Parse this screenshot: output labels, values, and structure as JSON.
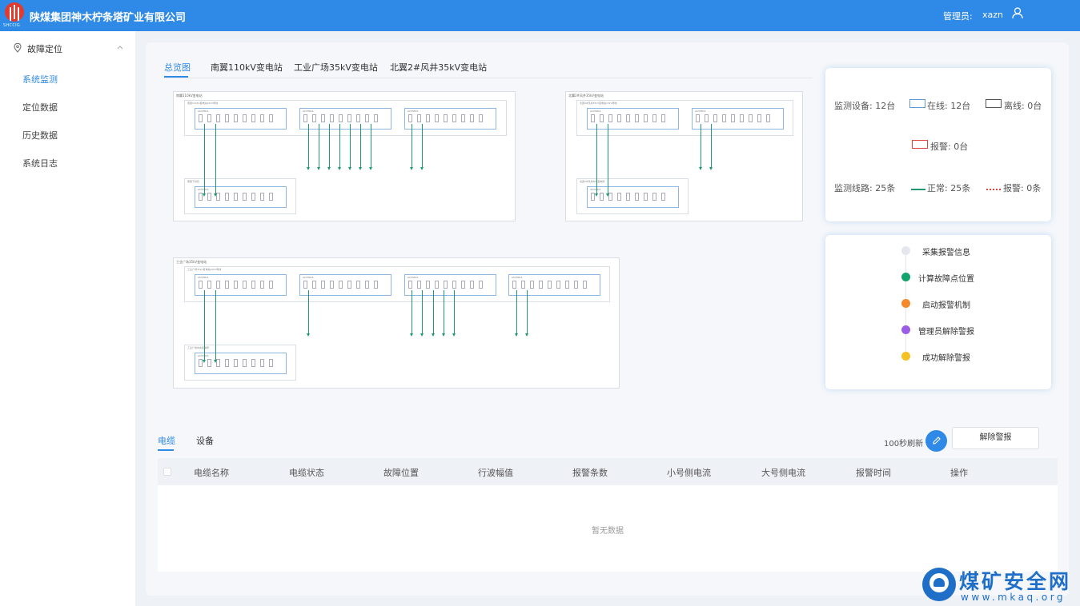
{
  "header": {
    "logo_text": "SHCCIG",
    "title": "陕煤集团神木柠条塔矿业有限公司",
    "admin_label": "管理员:",
    "admin_user": "xazn",
    "user_icon": "user-icon"
  },
  "sidebar": {
    "group_label": "故障定位",
    "group_icon": "location-pin-icon",
    "items": [
      {
        "label": "系统监测",
        "active": true
      },
      {
        "label": "定位数据",
        "active": false
      },
      {
        "label": "历史数据",
        "active": false
      },
      {
        "label": "系统日志",
        "active": false
      }
    ]
  },
  "top_tabs": [
    {
      "label": "总览图",
      "active": true
    },
    {
      "label": "南翼110kV变电站",
      "active": false
    },
    {
      "label": "工业广场35kV变电站",
      "active": false
    },
    {
      "label": "北翼2#风井35kV变电站",
      "active": false
    }
  ],
  "diagrams": {
    "d1": {
      "title": "南翼110kV变电站",
      "bus1": "南翼110kV变电站10kV母线",
      "bus2": "南翼下煤仓"
    },
    "d2": {
      "title": "北翼2#风井35kV变电站",
      "bus1": "北翼2#风井35kV变电站10kV母线",
      "bus2": "北翼2#风井中央变电所"
    },
    "d3": {
      "title": "工业广场35kV变电站",
      "bus1": "工业广场35kV变电站10kV母线",
      "bus2": "工业广场中央变电所"
    },
    "panel_label": "ACV5811"
  },
  "stats": {
    "devices_label": "监测设备: 12台",
    "online_label": "在线: 12台",
    "offline_label": "离线: 0台",
    "alarm_dev_label": "报警: 0台",
    "lines_label": "监测线路: 25条",
    "normal_label": "正常: 25条",
    "alarm_line_label": "报警: 0条",
    "colors": {
      "online": "#5b9bd5",
      "offline": "#555555",
      "alarm": "#e0413a",
      "normal": "#1f9a6e"
    }
  },
  "flow": [
    {
      "label": "采集报警信息",
      "color": "#e4e7ed"
    },
    {
      "label": "计算故障点位置",
      "color": "#13a36d"
    },
    {
      "label": "启动报警机制",
      "color": "#f38a2b"
    },
    {
      "label": "管理员解除警报",
      "color": "#9b5de5"
    },
    {
      "label": "成功解除警报",
      "color": "#f5c024"
    }
  ],
  "bottom_tabs": [
    {
      "label": "电缆",
      "active": true
    },
    {
      "label": "设备",
      "active": false
    }
  ],
  "toolbar": {
    "refresh_text": "100秒刷新",
    "edit_icon": "pencil-icon",
    "clear_alarm_label": "解除警报"
  },
  "table": {
    "columns": [
      "电缆名称",
      "电缆状态",
      "故障位置",
      "行波幅值",
      "报警条数",
      "小号侧电流",
      "大号侧电流",
      "报警时间",
      "操作"
    ],
    "empty_text": "暂无数据"
  },
  "watermark": {
    "title": "煤矿安全网",
    "url": "www.mkaq.org"
  }
}
